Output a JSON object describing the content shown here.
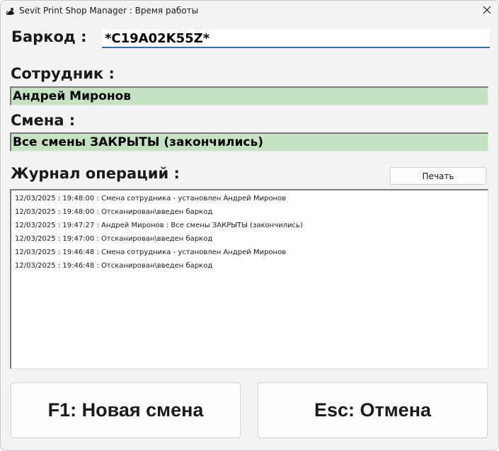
{
  "window": {
    "title": "Sevit Print Shop Manager : Время работы",
    "app_icon": "rat-icon",
    "close_icon": "close-icon"
  },
  "barcode": {
    "label": "Баркод :",
    "value": "*C19A02K55Z*"
  },
  "employee": {
    "label": "Сотрудник :",
    "value": "Андрей Миронов"
  },
  "shift": {
    "label": "Смена :",
    "value": "Все смены ЗАКРЫТЫ (закончились)"
  },
  "journal": {
    "label": "Журнал операций :",
    "print_label": "Печать",
    "entries": [
      "12/03/2025 : 19:48:00 :  Смена сотрудника - установлен Андрей Миронов",
      "12/03/2025 : 19:48:00 :  Отсканирован\\введен баркод",
      "12/03/2025 : 19:47:27 :  Андрей Миронов : Все смены ЗАКРЫТЫ (закончились)",
      "12/03/2025 : 19:47:00 :  Отсканирован\\введен баркод",
      "12/03/2025 : 19:46:48 :  Смена сотрудника - установлен Андрей Миронов",
      "12/03/2025 : 19:46:48 :  Отсканирован\\введен баркод"
    ]
  },
  "actions": {
    "new_shift_label": "F1: Новая смена",
    "cancel_label": "Esc: Отмена"
  },
  "colors": {
    "field_green": "#c5e3c2",
    "input_underline": "#2f6fb5",
    "window_bg": "#f3f3f3"
  }
}
